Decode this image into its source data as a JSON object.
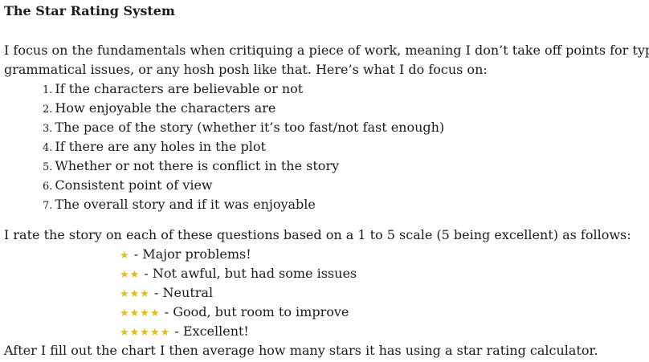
{
  "title": "The Star Rating System",
  "intro": {
    "line1": "I focus on the fundamentals when critiquing a piece of work, meaning I don’t take off points for typos,",
    "line2": "grammatical issues, or any hosh posh like that. Here’s what I do focus on:"
  },
  "criteria": [
    {
      "num": "1.",
      "text": "If the characters are believable or not"
    },
    {
      "num": "2.",
      "text": "How enjoyable the characters are"
    },
    {
      "num": "3.",
      "text": "The pace of the story (whether it’s too fast/not fast enough)"
    },
    {
      "num": "4.",
      "text": "If there are any holes in the plot"
    },
    {
      "num": "5.",
      "text": "Whether or not there is conflict in the story"
    },
    {
      "num": "6.",
      "text": "Consistent point of view"
    },
    {
      "num": "7.",
      "text": "The overall story and if it was enjoyable"
    }
  ],
  "scale_intro": "I rate the story on each of these questions based on a 1 to 5 scale (5 being excellent) as follows:",
  "ratings": [
    {
      "stars": "★",
      "text": " - Major problems!"
    },
    {
      "stars": "★★",
      "text": " - Not awful, but had some issues"
    },
    {
      "stars": "★★★",
      "text": " - Neutral"
    },
    {
      "stars": "★★★★",
      "text": " - Good, but room to improve"
    },
    {
      "stars": "★★★★★",
      "text": " - Excellent!"
    }
  ],
  "closing": "After I fill out the chart I then average how many stars it has using a star rating calculator.",
  "colors": {
    "star": "#e8b81a",
    "text": "#1b1b1b"
  }
}
